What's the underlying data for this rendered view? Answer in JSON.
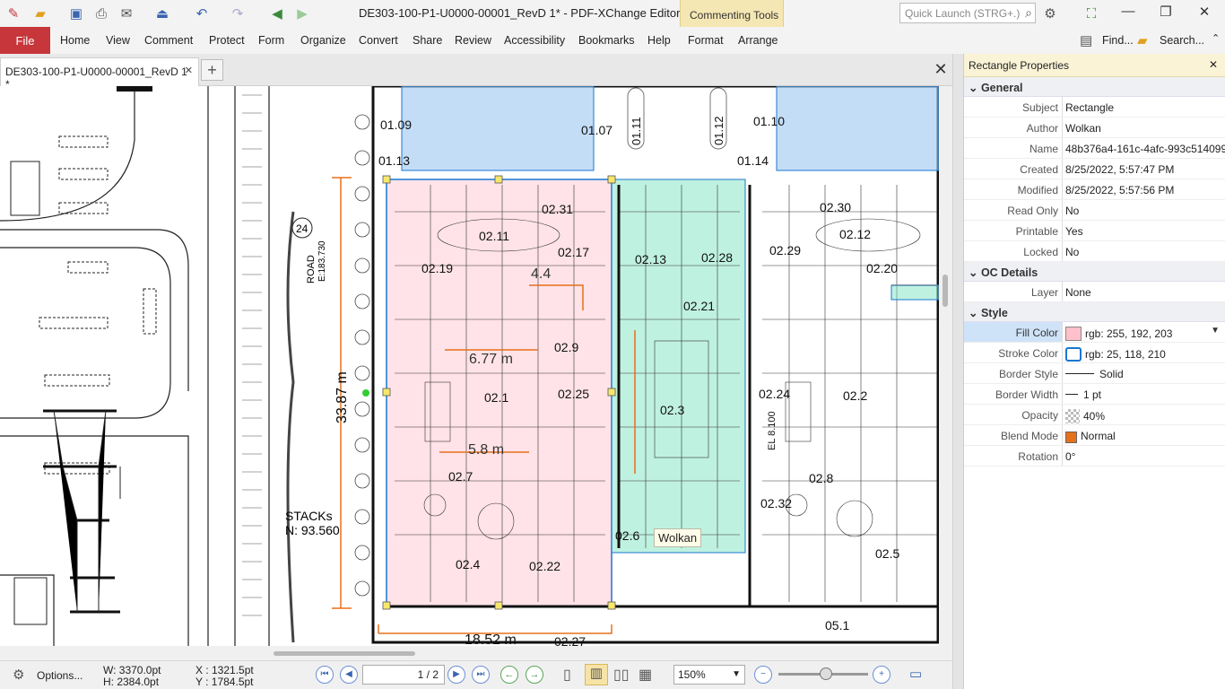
{
  "app": {
    "title": "DE303-100-P1-U0000-00001_RevD 1* - PDF-XChange Editor",
    "context_group": "Commenting Tools"
  },
  "search": {
    "placeholder": "Quick Launch (STRG+.)",
    "find_label": "Find...",
    "search_label": "Search..."
  },
  "menu": {
    "file": "File",
    "items": [
      "Home",
      "View",
      "Comment",
      "Protect",
      "Form",
      "Organize",
      "Convert",
      "Share",
      "Review",
      "Accessibility",
      "Bookmarks",
      "Help"
    ],
    "context_items": [
      "Format",
      "Arrange"
    ]
  },
  "tab": {
    "label": "DE303-100-P1-U0000-00001_RevD 1 *"
  },
  "drawing": {
    "road_label": "ROAD",
    "road_coord": "E:183.730",
    "road_num": "24",
    "stacks": "STACKs",
    "stacks_coord": "N: 93.560",
    "dim_vertical": "33.87 m",
    "dim_bottom": "18.52 m",
    "dim_a": "6.77 m",
    "dim_b": "5.8 m",
    "dim_c": "4.4",
    "el_label": "EL 8.100",
    "rooms": [
      "01.09",
      "01.13",
      "01.07",
      "01.11",
      "01.12",
      "01.10",
      "01.14",
      "02.31",
      "02.11",
      "02.17",
      "02.19",
      "02.13",
      "02.28",
      "02.9",
      "02.1",
      "02.25",
      "02.7",
      "02.4",
      "02.22",
      "02.21",
      "02.3",
      "02.6",
      "02.30",
      "02.12",
      "02.29",
      "02.20",
      "02.24",
      "02.2",
      "02.8",
      "02.32",
      "02.5",
      "02.27",
      "05.1"
    ],
    "annotation_author_label": "Wolkan"
  },
  "status": {
    "width": "W: 3370.0pt",
    "height": "H: 2384.0pt",
    "x": "X : 1321.5pt",
    "y": "Y : 1784.5pt",
    "options": "Options...",
    "page": "1 / 2",
    "zoom": "150%"
  },
  "panel": {
    "title": "Rectangle Properties",
    "general": {
      "title": "General",
      "rows": [
        {
          "k": "Subject",
          "v": "Rectangle"
        },
        {
          "k": "Author",
          "v": "Wolkan"
        },
        {
          "k": "Name",
          "v": "48b376a4-161c-4afc-993c514099..."
        },
        {
          "k": "Created",
          "v": "8/25/2022, 5:57:47 PM"
        },
        {
          "k": "Modified",
          "v": "8/25/2022, 5:57:56 PM"
        },
        {
          "k": "Read Only",
          "v": "No"
        },
        {
          "k": "Printable",
          "v": "Yes"
        },
        {
          "k": "Locked",
          "v": "No"
        }
      ]
    },
    "oc": {
      "title": "OC Details",
      "rows": [
        {
          "k": "Layer",
          "v": "None"
        }
      ]
    },
    "style": {
      "title": "Style",
      "rows": [
        {
          "k": "Fill Color",
          "v": "rgb: 255, 192, 203"
        },
        {
          "k": "Stroke Color",
          "v": "rgb: 25, 118, 210"
        },
        {
          "k": "Border Style",
          "v": "Solid"
        },
        {
          "k": "Border Width",
          "v": "1 pt"
        },
        {
          "k": "Opacity",
          "v": "40%"
        },
        {
          "k": "Blend Mode",
          "v": "Normal"
        },
        {
          "k": "Rotation",
          "v": "0°"
        }
      ]
    }
  },
  "colors": {
    "fill": "#ffc0cb",
    "stroke": "#1976d2",
    "file_tab": "#c6363b",
    "blend": "#e8701a"
  }
}
